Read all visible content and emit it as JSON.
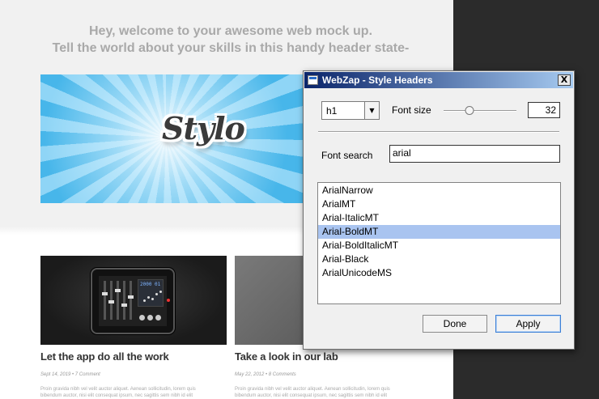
{
  "mockup": {
    "welcome_line1": "Hey, welcome to your awesome web mock up.",
    "welcome_line2": "Tell the world about your skills in this handy header state-",
    "banner_logo": "Stylo",
    "tablet_readout": "2000 01",
    "cards": [
      {
        "title": "Let the app do all the work",
        "meta": "Sept 14, 2019 • 7 Comment",
        "text_line1": "Proin gravida nibh vel velit auctor aliquet. Aenean sollicitudin, lorem quis",
        "text_line2": "bibendum auctor, nisi elit consequat ipsum, nec sagittis sem nibh id elit"
      },
      {
        "title": "Take a look in our lab",
        "meta": "May 22, 2012 • 8 Comments",
        "text_line1": "Proin gravida nibh vel velit auctor aliquet. Aenean sollicitudin, lorem quis",
        "text_line2": "bibendum auctor, nisi elit consequat ipsum, nec sagittis sem nibh id elit"
      }
    ]
  },
  "dialog": {
    "title": "WebZap - Style Headers",
    "close_glyph": "X",
    "heading_level": "h1",
    "dropdown_glyph": "▼",
    "font_size_label": "Font size",
    "font_size_value": "32",
    "font_size_slider_fraction": 0.35,
    "font_search_label": "Font search",
    "font_search_value": "arial",
    "fonts": [
      "ArialNarrow",
      "ArialMT",
      "Arial-ItalicMT",
      "Arial-BoldMT",
      "Arial-BoldItalicMT",
      "Arial-Black",
      "ArialUnicodeMS"
    ],
    "selected_font_index": 3,
    "done_label": "Done",
    "apply_label": "Apply"
  },
  "colors": {
    "titlebar_start": "#0a246a",
    "titlebar_end": "#a6caf0",
    "selection": "#a9c4f0",
    "banner_blue": "#47b6ea"
  }
}
